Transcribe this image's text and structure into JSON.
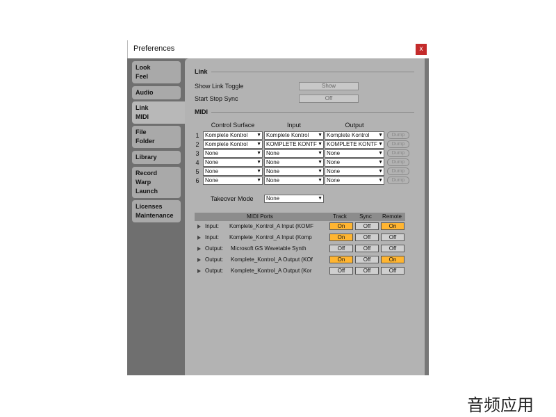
{
  "window": {
    "title": "Preferences",
    "close_label": "x"
  },
  "sidebar": [
    {
      "lines": [
        "Look",
        "Feel"
      ]
    },
    {
      "lines": [
        "Audio"
      ]
    },
    {
      "lines": [
        "Link",
        "MIDI"
      ],
      "selected": true
    },
    {
      "lines": [
        "File",
        "Folder"
      ]
    },
    {
      "lines": [
        "Library"
      ]
    },
    {
      "lines": [
        "Record",
        "Warp",
        "Launch"
      ]
    },
    {
      "lines": [
        "Licenses",
        "Maintenance"
      ]
    }
  ],
  "link": {
    "section": "Link",
    "show_toggle_label": "Show Link Toggle",
    "show_toggle_value": "Show",
    "start_stop_label": "Start Stop Sync",
    "start_stop_value": "Off"
  },
  "midi": {
    "section": "MIDI",
    "headers": {
      "control_surface": "Control Surface",
      "input": "Input",
      "output": "Output"
    },
    "dump_label": "Dump",
    "rows": [
      {
        "num": "1",
        "surface": "Komplete Kontrol",
        "input": "Komplete Kontrol",
        "output": "Komplete Kontrol"
      },
      {
        "num": "2",
        "surface": "Komplete Kontrol",
        "input": "KOMPLETE KONTF",
        "output": "KOMPLETE KONTF"
      },
      {
        "num": "3",
        "surface": "None",
        "input": "None",
        "output": "None"
      },
      {
        "num": "4",
        "surface": "None",
        "input": "None",
        "output": "None"
      },
      {
        "num": "5",
        "surface": "None",
        "input": "None",
        "output": "None"
      },
      {
        "num": "6",
        "surface": "None",
        "input": "None",
        "output": "None"
      }
    ],
    "takeover_label": "Takeover Mode",
    "takeover_value": "None"
  },
  "ports": {
    "headers": {
      "ports": "MIDI Ports",
      "track": "Track",
      "sync": "Sync",
      "remote": "Remote"
    },
    "rows": [
      {
        "type": "Input:",
        "name": "Komplete_Kontrol_A Input (KOMF",
        "track": "On",
        "sync": "Off",
        "remote": "On"
      },
      {
        "type": "Input:",
        "name": "Komplete_Kontrol_A Input (Komp",
        "track": "On",
        "sync": "Off",
        "remote": "Off"
      },
      {
        "type": "Output:",
        "name": "Microsoft GS Wavetable Synth",
        "track": "Off",
        "sync": "Off",
        "remote": "Off"
      },
      {
        "type": "Output:",
        "name": "Komplete_Kontrol_A Output (KOf",
        "track": "On",
        "sync": "Off",
        "remote": "On"
      },
      {
        "type": "Output:",
        "name": "Komplete_Kontrol_A Output (Kor",
        "track": "Off",
        "sync": "Off",
        "remote": "Off"
      }
    ]
  },
  "watermark": "音频应用",
  "colors": {
    "toggle_on": "#ffb531",
    "toggle_off": "#cfcfcf",
    "close": "#c42b2b"
  }
}
